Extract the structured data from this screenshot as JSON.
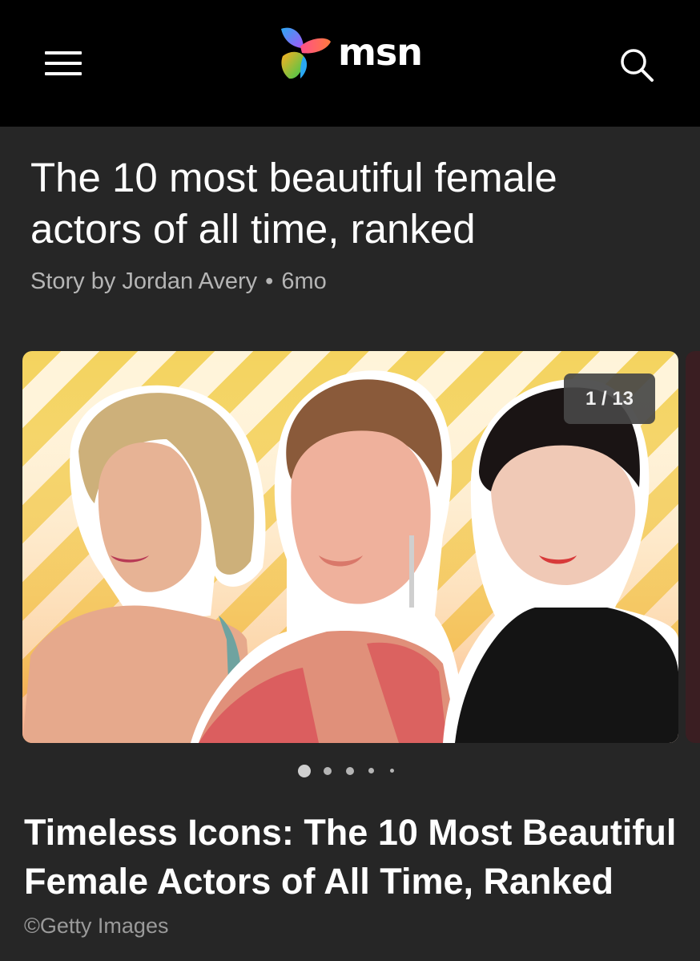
{
  "header": {
    "logo_text": "msn",
    "menu_icon": "hamburger-menu-icon",
    "search_icon": "search-icon",
    "colors": {
      "background": "#000000",
      "logo_butterfly": [
        "#2aa8f2",
        "#a855f7",
        "#ff4f8b",
        "#ffb020",
        "#35c94f"
      ]
    }
  },
  "article": {
    "headline": "The 10 most beautiful female actors of all time, ranked",
    "byline": {
      "author": "Story by Jordan Avery",
      "separator": "•",
      "age": "6mo"
    }
  },
  "slideshow": {
    "counter": "1 / 13",
    "current_slide": 1,
    "total_slides": 13,
    "visible_dots": 5,
    "active_dot": 1,
    "caption": "Timeless Icons: The 10 Most Beautiful Female Actors of All Time, Ranked",
    "credit": "©Getty Images",
    "image_description_icon": "slide-image"
  },
  "colors": {
    "page_background": "#262626",
    "byline_text": "#b5b5b5",
    "credit_text": "#9a9a9a",
    "counter_background": "#464646"
  }
}
